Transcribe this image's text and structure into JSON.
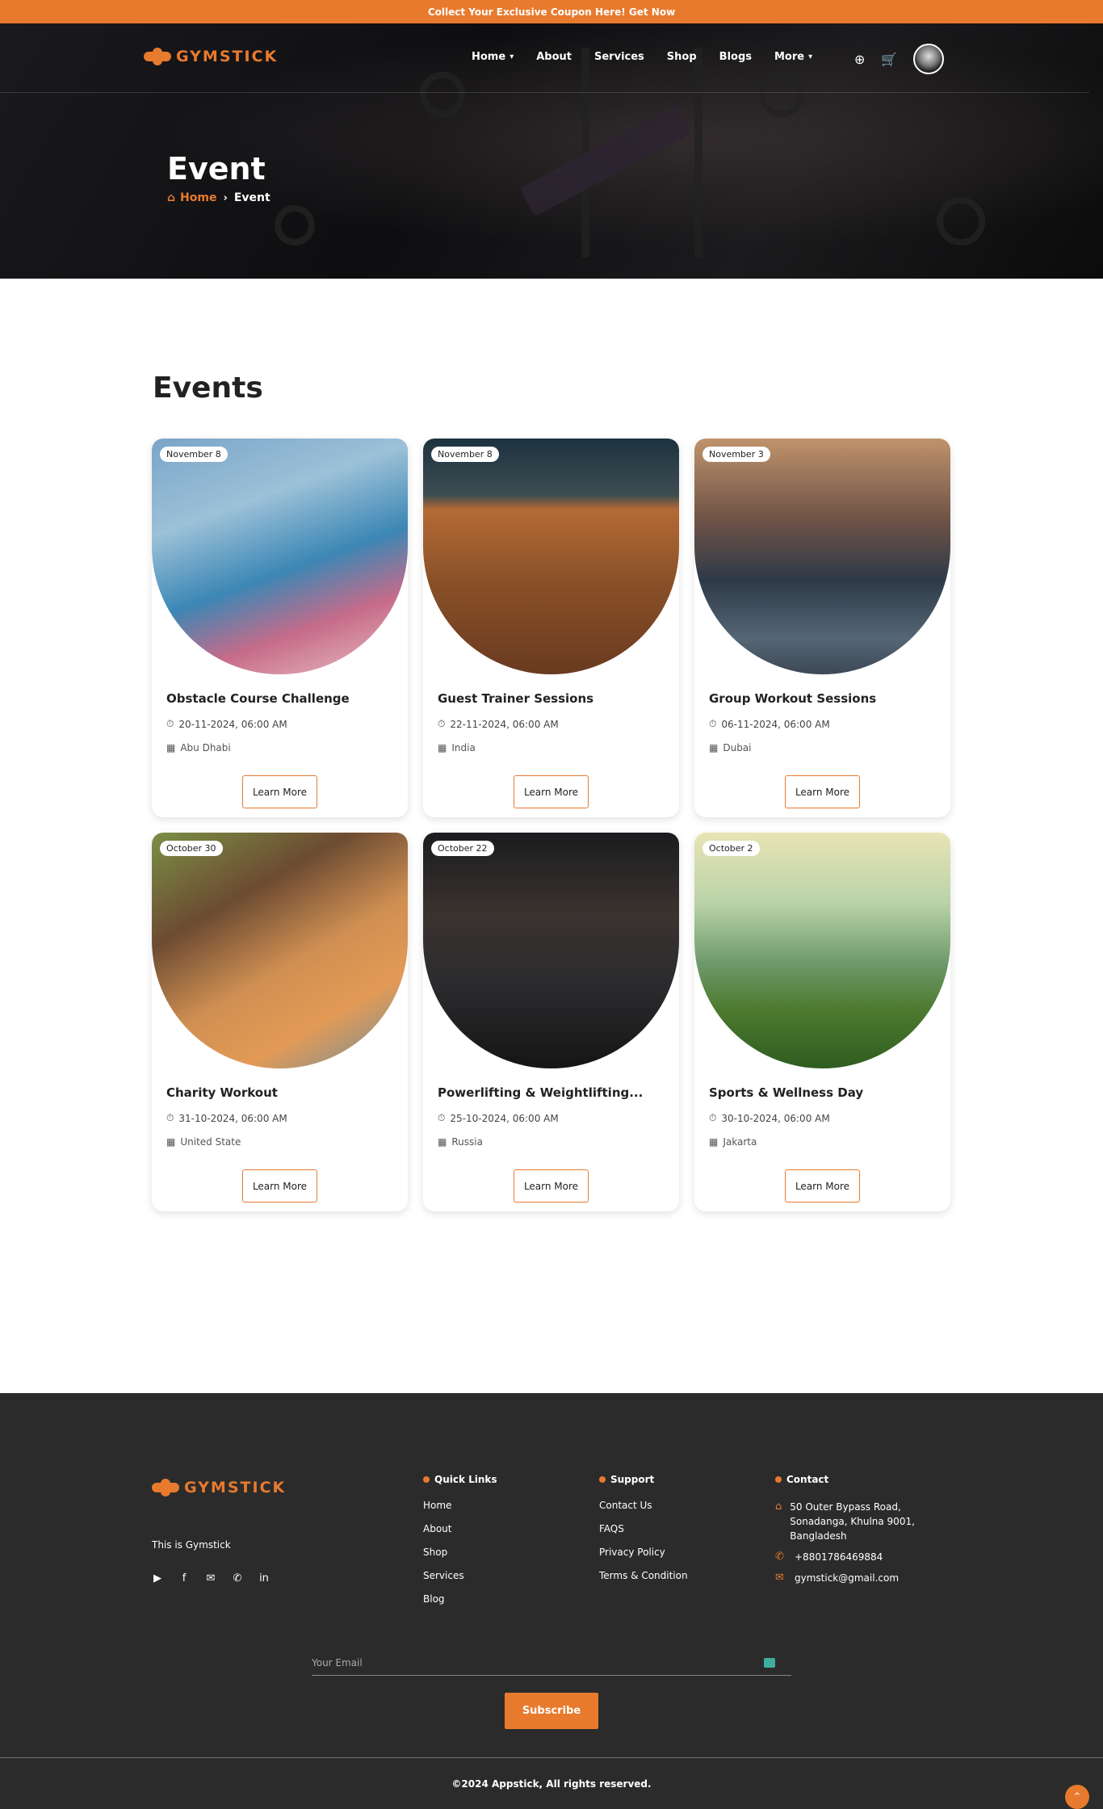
{
  "promo": {
    "text": "Collect Your Exclusive Coupon Here! Get Now"
  },
  "brand": {
    "name": "GYMSTICK",
    "accent": "#e87a2e"
  },
  "nav": {
    "items": [
      {
        "label": "Home",
        "dropdown": true
      },
      {
        "label": "About",
        "dropdown": false
      },
      {
        "label": "Services",
        "dropdown": false
      },
      {
        "label": "Shop",
        "dropdown": false
      },
      {
        "label": "Blogs",
        "dropdown": false
      },
      {
        "label": "More",
        "dropdown": true
      }
    ],
    "icons": [
      "globe-icon",
      "cart-icon",
      "avatar"
    ]
  },
  "hero": {
    "title": "Event",
    "breadcrumb": {
      "home": "Home",
      "current": "Event"
    }
  },
  "events": {
    "heading": "Events",
    "button_label": "Learn More",
    "items": [
      {
        "badge": "November 8",
        "title": "Obstacle Course Challenge",
        "datetime": "20-11-2024, 06:00 AM",
        "location": "Abu Dhabi"
      },
      {
        "badge": "November 8",
        "title": "Guest Trainer Sessions",
        "datetime": "22-11-2024, 06:00 AM",
        "location": "India"
      },
      {
        "badge": "November 3",
        "title": "Group Workout Sessions",
        "datetime": "06-11-2024, 06:00 AM",
        "location": "Dubai"
      },
      {
        "badge": "October 30",
        "title": "Charity Workout",
        "datetime": "31-10-2024, 06:00 AM",
        "location": "United State"
      },
      {
        "badge": "October 22",
        "title": "Powerlifting & Weightlifting...",
        "datetime": "25-10-2024, 06:00 AM",
        "location": "Russia"
      },
      {
        "badge": "October 2",
        "title": "Sports & Wellness Day",
        "datetime": "30-10-2024, 06:00 AM",
        "location": "Jakarta"
      }
    ]
  },
  "footer": {
    "tagline": "This is Gymstick",
    "social": [
      "youtube-icon",
      "facebook-icon",
      "mail-icon",
      "phone-icon",
      "linkedin-icon"
    ],
    "quick_links": {
      "title": "Quick Links",
      "items": [
        "Home",
        "About",
        "Shop",
        "Services",
        "Blog"
      ]
    },
    "support": {
      "title": "Support",
      "items": [
        "Contact Us",
        "FAQS",
        "Privacy Policy",
        "Terms & Condition"
      ]
    },
    "contact": {
      "title": "Contact",
      "address": "50 Outer Bypass Road, Sonadanga, Khulna 9001, Bangladesh",
      "phone": "+8801786469884",
      "email": "gymstick@gmail.com"
    },
    "subscribe": {
      "placeholder": "Your Email",
      "button": "Subscribe"
    },
    "copyright": "©2024 Appstick, All rights reserved."
  }
}
